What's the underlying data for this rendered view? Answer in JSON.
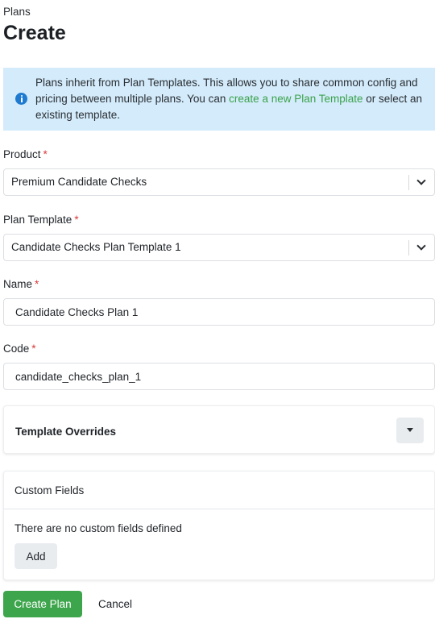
{
  "breadcrumb": "Plans",
  "title": "Create",
  "info": {
    "icon": "info-icon",
    "text_before": "Plans inherit from Plan Templates. This allows you to share common config and pricing between multiple plans. You can ",
    "link": "create a new Plan Template",
    "text_after": " or select an existing template."
  },
  "required_marker": "*",
  "product": {
    "label": "Product",
    "value": "Premium Candidate Checks"
  },
  "plan_template": {
    "label": "Plan Template",
    "value": "Candidate Checks Plan Template 1"
  },
  "name": {
    "label": "Name",
    "value": "Candidate Checks Plan 1"
  },
  "code": {
    "label": "Code",
    "value": "candidate_checks_plan_1"
  },
  "template_overrides": {
    "title": "Template Overrides"
  },
  "custom_fields": {
    "title": "Custom Fields",
    "empty_text": "There are no custom fields defined",
    "add_label": "Add"
  },
  "actions": {
    "create": "Create Plan",
    "cancel": "Cancel"
  },
  "colors": {
    "accent": "#3da64c",
    "info_bg": "#d3ebfb",
    "info_icon": "#1f7bd0",
    "required": "#d93a3a"
  }
}
